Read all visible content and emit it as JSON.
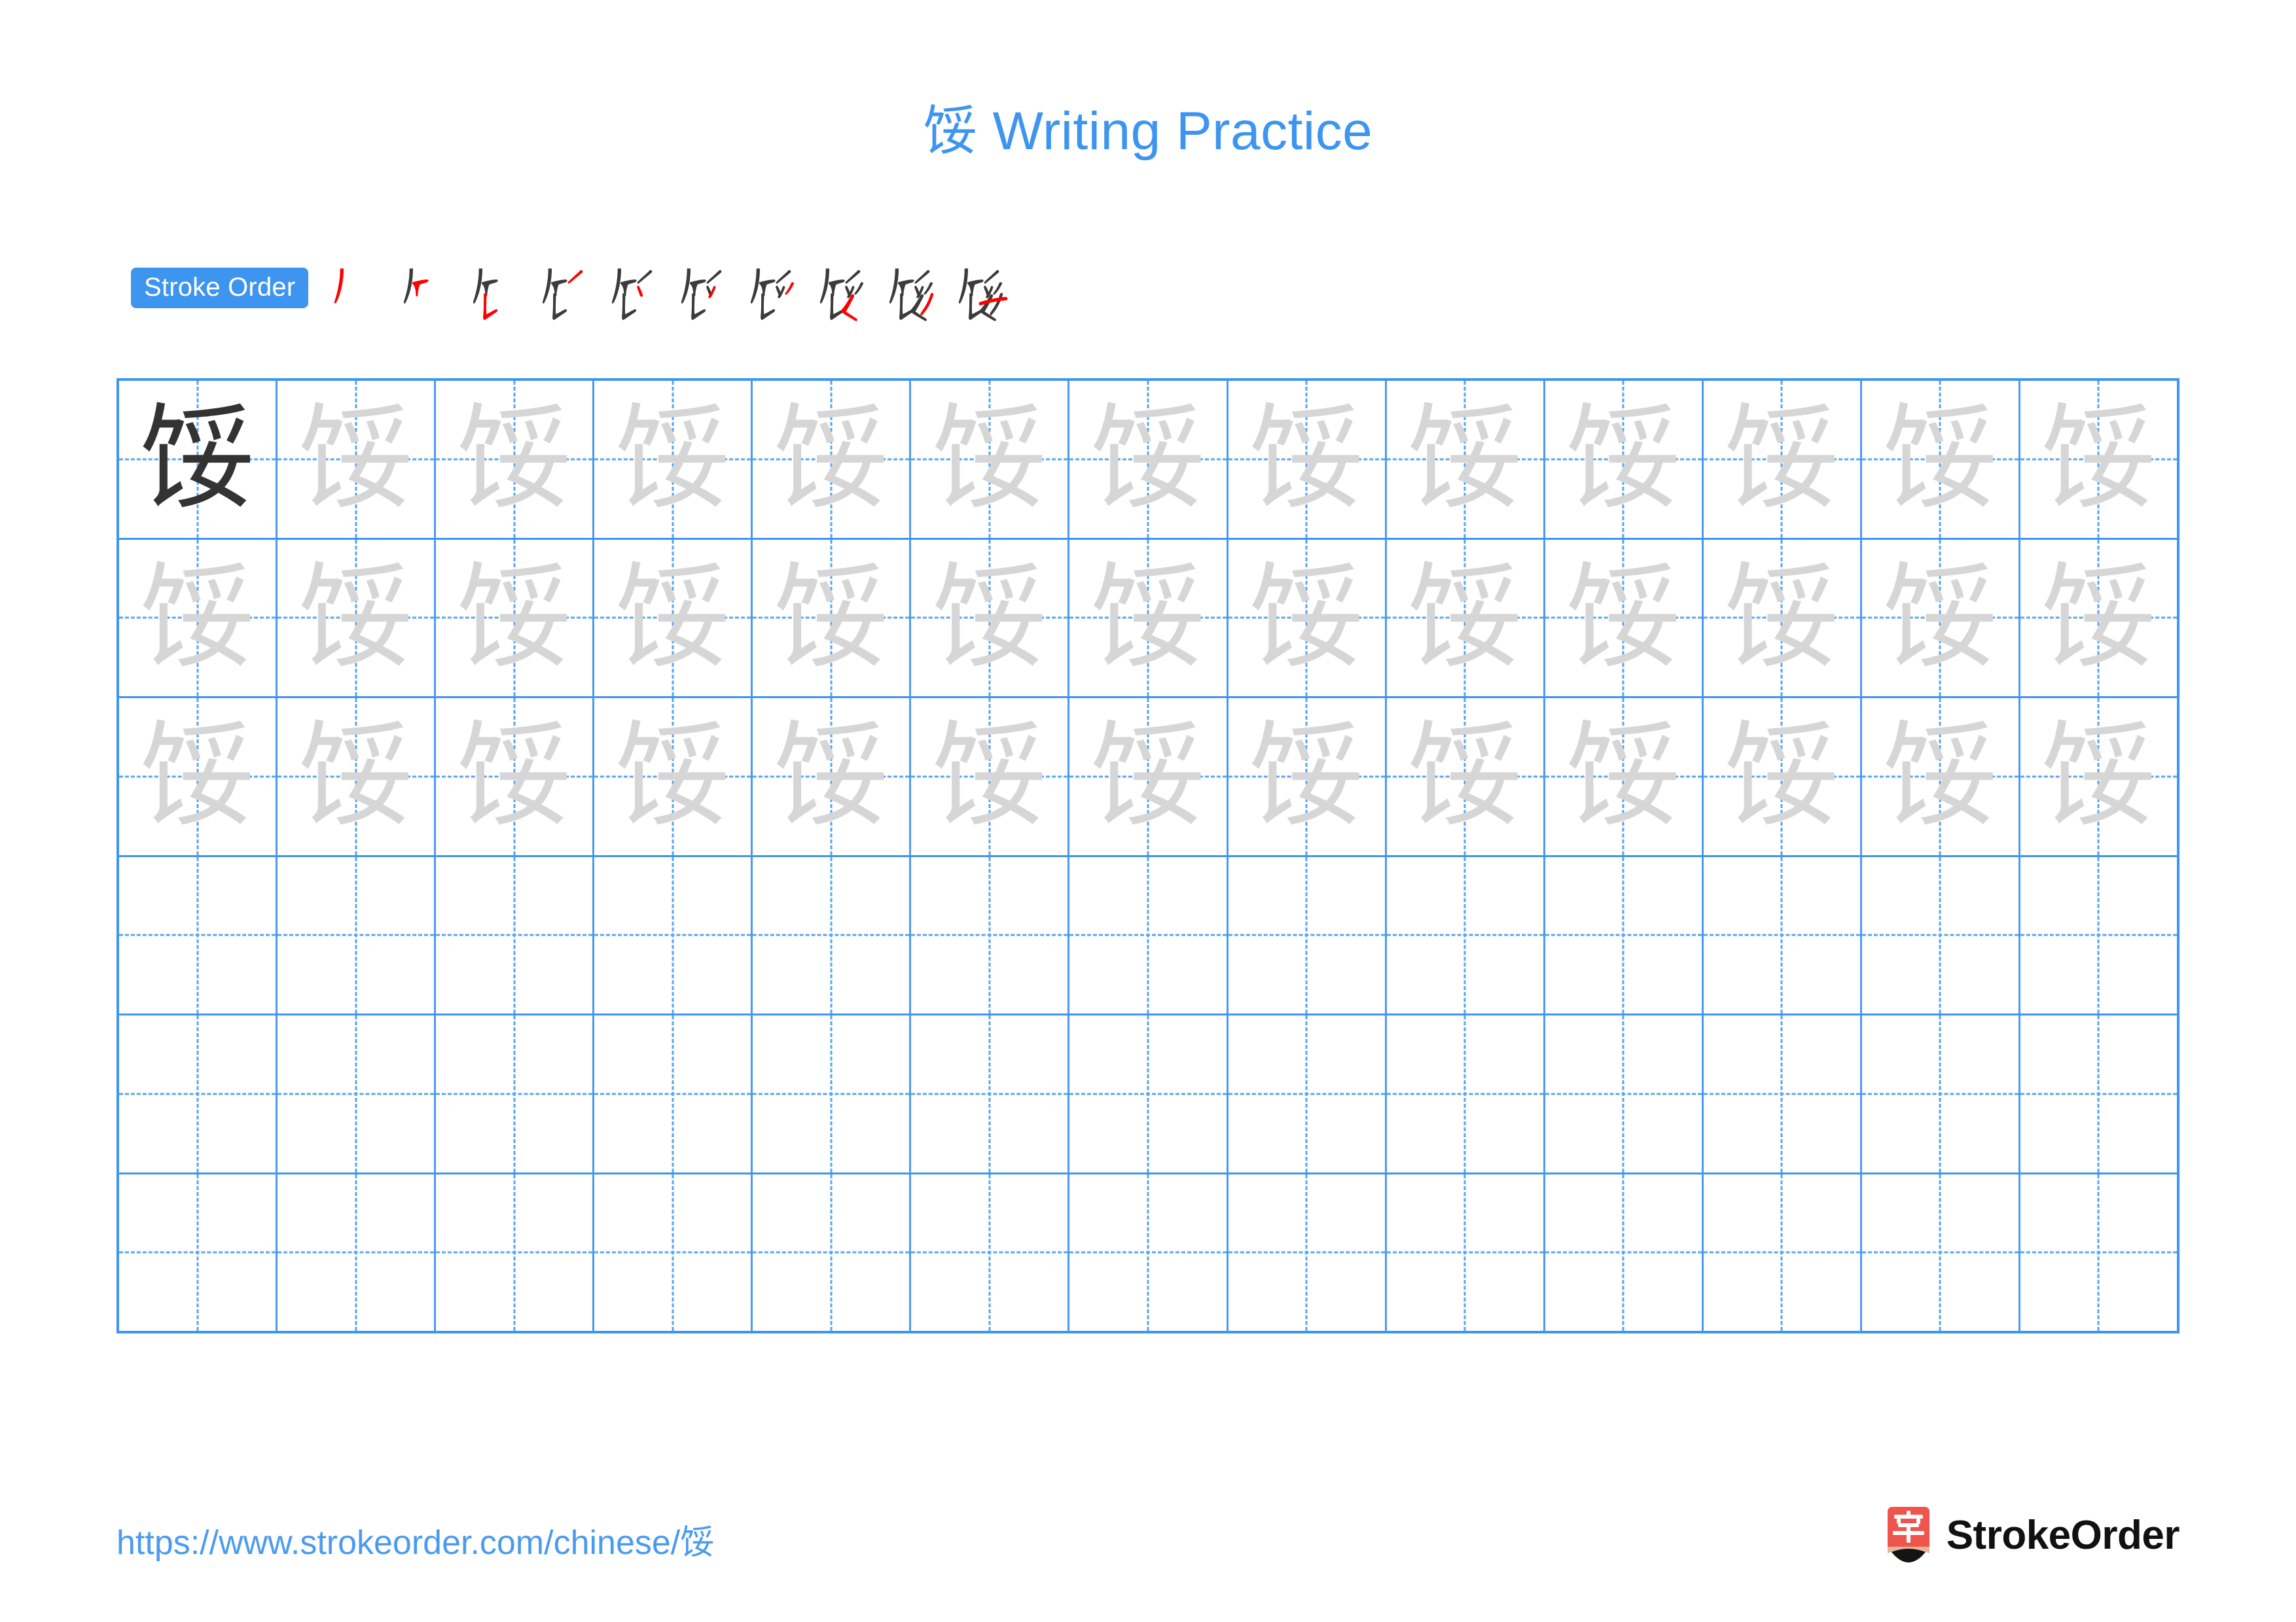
{
  "character": "馁",
  "title": {
    "character": "馁",
    "suffix": " Writing Practice",
    "full": "馁 Writing Practice",
    "color": "#3d95f0"
  },
  "stroke_order": {
    "badge_label": "Stroke Order",
    "badge_bg": "#3d95f0",
    "badge_text_color": "#ffffff",
    "new_stroke_color": "#ff0000",
    "done_stroke_color": "#3b3b3b",
    "total_strokes": 10,
    "steps": [
      {
        "index": 1,
        "name": "stroke-step-1",
        "new_stroke": "撇 (pie)"
      },
      {
        "index": 2,
        "name": "stroke-step-2",
        "new_stroke": "横折 (heng zhe)"
      },
      {
        "index": 3,
        "name": "stroke-step-3",
        "new_stroke": "竖提 (shu ti)"
      },
      {
        "index": 4,
        "name": "stroke-step-4",
        "new_stroke": "撇 (pie)"
      },
      {
        "index": 5,
        "name": "stroke-step-5",
        "new_stroke": "点 (dian)"
      },
      {
        "index": 6,
        "name": "stroke-step-6",
        "new_stroke": "撇 (pie)"
      },
      {
        "index": 7,
        "name": "stroke-step-7",
        "new_stroke": "捺 (na)"
      },
      {
        "index": 8,
        "name": "stroke-step-8",
        "new_stroke": "撇折 (pie zhe)"
      },
      {
        "index": 9,
        "name": "stroke-step-9",
        "new_stroke": "撇 (pie)"
      },
      {
        "index": 10,
        "name": "stroke-step-10",
        "new_stroke": "横 (heng)"
      }
    ]
  },
  "grid": {
    "columns": 13,
    "rows": 6,
    "border_color": "#3d95f0",
    "guide_color": "#5aa5f2",
    "model_char_color": "#333333",
    "trace_char_color": "#d6d6d6",
    "row_types": [
      "traced",
      "traced",
      "traced",
      "blank",
      "blank",
      "blank"
    ],
    "cells": [
      [
        "馁",
        "馁",
        "馁",
        "馁",
        "馁",
        "馁",
        "馁",
        "馁",
        "馁",
        "馁",
        "馁",
        "馁",
        "馁"
      ],
      [
        "馁",
        "馁",
        "馁",
        "馁",
        "馁",
        "馁",
        "馁",
        "馁",
        "馁",
        "馁",
        "馁",
        "馁",
        "馁"
      ],
      [
        "馁",
        "馁",
        "馁",
        "馁",
        "馁",
        "馁",
        "馁",
        "馁",
        "馁",
        "馁",
        "馁",
        "馁",
        "馁"
      ],
      [
        "",
        "",
        "",
        "",
        "",
        "",
        "",
        "",
        "",
        "",
        "",
        "",
        ""
      ],
      [
        "",
        "",
        "",
        "",
        "",
        "",
        "",
        "",
        "",
        "",
        "",
        "",
        ""
      ],
      [
        "",
        "",
        "",
        "",
        "",
        "",
        "",
        "",
        "",
        "",
        "",
        "",
        ""
      ]
    ]
  },
  "footer": {
    "url": "https://www.strokeorder.com/chinese/馁",
    "url_color": "#4a9bf0",
    "brand_name": "StrokeOrder",
    "brand_mark_char": "字",
    "brand_mark_color": "#f0554d",
    "brand_mark_tip_color": "#e0b99a"
  }
}
